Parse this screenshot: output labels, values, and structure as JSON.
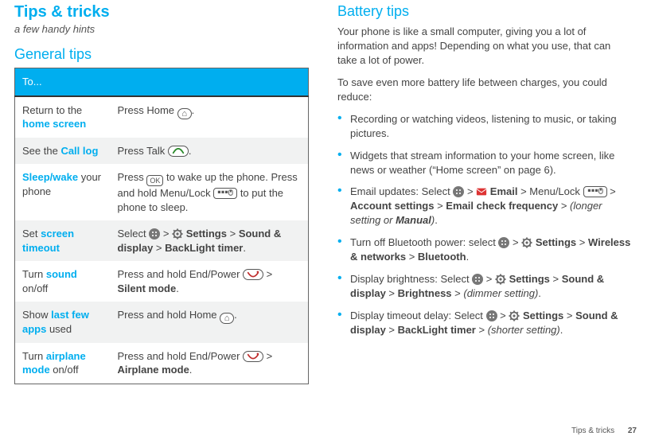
{
  "left": {
    "title": "Tips & tricks",
    "subtitle": "a few handy hints",
    "section": "General tips",
    "table_header": "To...",
    "rows": [
      {
        "left_pre": "Return to the ",
        "left_key": "home screen",
        "left_post": "",
        "r_pre": "Press Home ",
        "r_post": "."
      },
      {
        "left_pre": "See the ",
        "left_key": "Call log",
        "left_post": "",
        "r_pre": "Press Talk ",
        "r_post": "."
      },
      {
        "left_pre": "",
        "left_key": "Sleep/wake",
        "left_post": " your phone",
        "r_pre": "Press ",
        "r_mid": " to wake up the phone. Press and hold Menu/Lock ",
        "r_post": " to put the phone to sleep."
      },
      {
        "left_pre": "Set ",
        "left_key": "screen timeout",
        "left_post": "",
        "r_a": "Select ",
        "r_b": " > ",
        "r_c": " Settings",
        "r_d": " > ",
        "r_e": "Sound & display",
        "r_f": " > ",
        "r_g": "BackLight timer",
        "r_h": "."
      },
      {
        "left_pre": "Turn ",
        "left_key": "sound",
        "left_post": " on/off",
        "r_a": "Press and hold End/Power ",
        "r_b": " > ",
        "r_c": "Silent mode",
        "r_d": "."
      },
      {
        "left_pre": "Show ",
        "left_key": "last few apps",
        "left_post": " used",
        "r_pre": "Press and hold Home ",
        "r_post": "."
      },
      {
        "left_pre": "Turn ",
        "left_key": "airplane mode",
        "left_post": " on/off",
        "r_a": "Press and hold End/Power ",
        "r_b": " > ",
        "r_c": "Airplane mode",
        "r_d": "."
      }
    ],
    "ok_label": "OK"
  },
  "right": {
    "section": "Battery tips",
    "para1": "Your phone is like a small computer, giving you a lot of information and apps! Depending on what you use, that can take a lot of power.",
    "para2": "To save even more battery life between charges, you could reduce:",
    "bullets": [
      {
        "text": "Recording or watching videos, listening to music, or taking pictures."
      },
      {
        "text": "Widgets that stream information to your home screen, like news or weather (“Home screen” on page 6)."
      },
      {
        "a": "Email updates: Select ",
        "b": " > ",
        "c": " Email",
        "d": " > Menu/Lock ",
        "e": " > ",
        "f": "Account settings",
        "g": " > ",
        "h": "Email check frequency",
        "i": " > ",
        "j": "(longer setting or ",
        "k": "Manual",
        "l": ")",
        "m": "."
      },
      {
        "a": "Turn off Bluetooth power: select ",
        "b": " > ",
        "c": " Settings",
        "d": " > ",
        "e": "Wireless & networks",
        "f": " > ",
        "g": "Bluetooth",
        "h": "."
      },
      {
        "a": "Display brightness: Select ",
        "b": " > ",
        "c": " Settings",
        "d": " > ",
        "e": "Sound & display",
        "f": " > ",
        "g": "Brightness",
        "h": " > ",
        "i": "(dimmer setting)",
        "j": "."
      },
      {
        "a": "Display timeout delay: Select ",
        "b": " > ",
        "c": " Settings",
        "d": " > ",
        "e": "Sound & display",
        "f": " > ",
        "g": "BackLight timer",
        "h": " > ",
        "i": "(shorter setting)",
        "j": "."
      }
    ]
  },
  "footer": {
    "label": "Tips & tricks",
    "page": "27"
  }
}
